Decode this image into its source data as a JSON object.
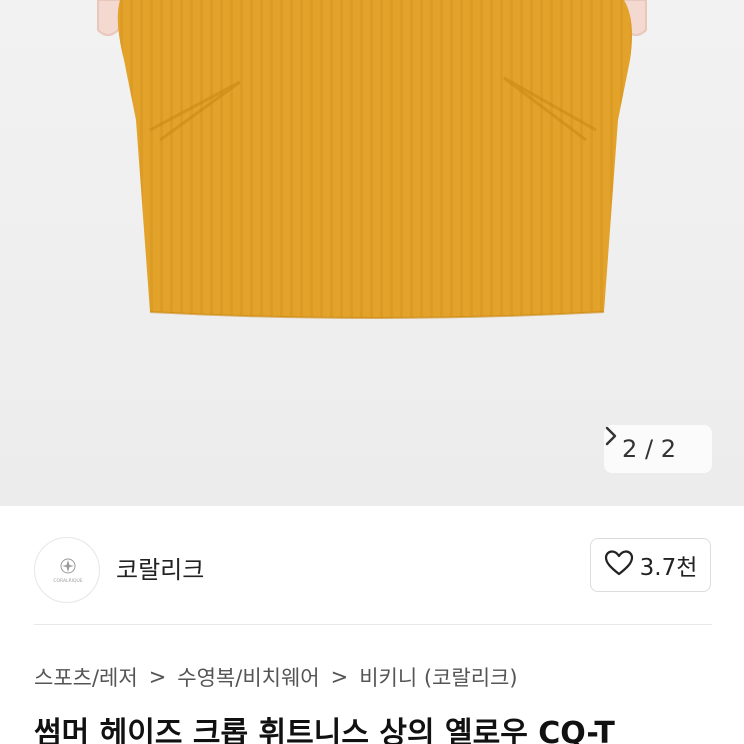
{
  "image_pager": {
    "current": "2",
    "separator": "/",
    "total": "2",
    "next_icon": "chevron-right-icon"
  },
  "seller": {
    "name": "코랄리크",
    "avatar_logo_text": "CORALRIQUE"
  },
  "like": {
    "icon": "heart-outline-icon",
    "count": "3.7천"
  },
  "breadcrumb": {
    "items": [
      "스포츠/레저",
      "수영복/비치웨어",
      "비키니 (코랄리크)"
    ],
    "separator": ">"
  },
  "product": {
    "title": "썸머 헤이즈 크롭 휘트니스 상의 옐로우 CQ-T"
  },
  "colors": {
    "garment": "#e3a22a",
    "hero_bg": "#efefef"
  }
}
